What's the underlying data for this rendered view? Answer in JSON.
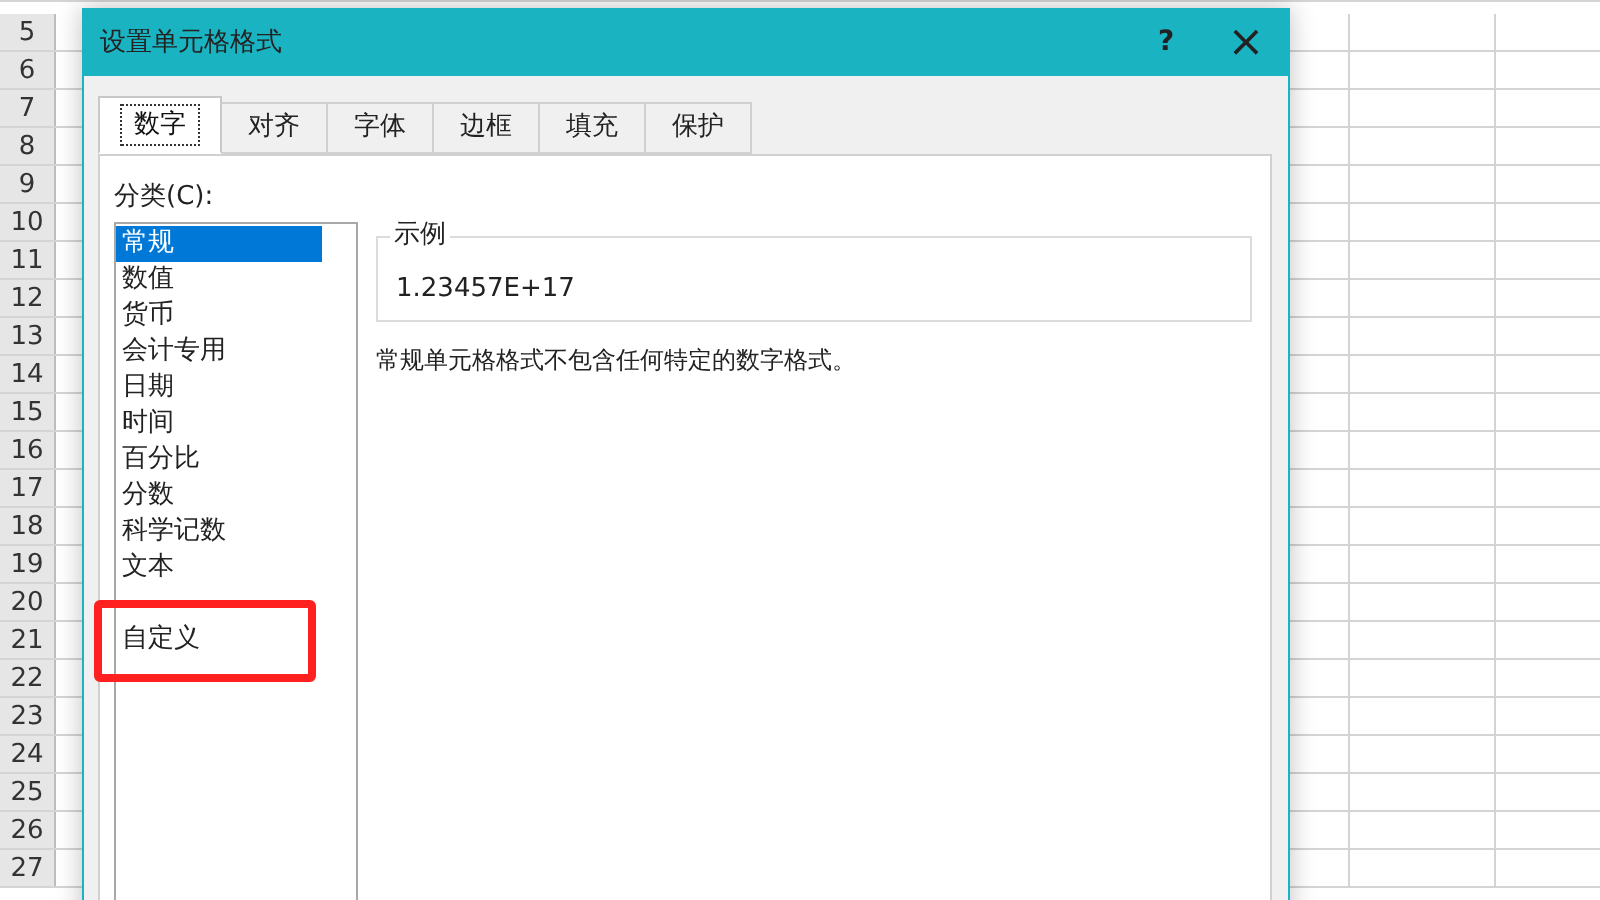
{
  "sheet": {
    "row_numbers": [
      "5",
      "6",
      "7",
      "8",
      "9",
      "10",
      "11",
      "12",
      "13",
      "14",
      "15",
      "16",
      "17",
      "18",
      "19",
      "20",
      "21",
      "22",
      "23",
      "24",
      "25",
      "26",
      "27"
    ]
  },
  "dialog": {
    "title": "设置单元格格式",
    "help": "?",
    "close": "×",
    "tabs": [
      {
        "label": "数字",
        "selected": true
      },
      {
        "label": "对齐",
        "selected": false
      },
      {
        "label": "字体",
        "selected": false
      },
      {
        "label": "边框",
        "selected": false
      },
      {
        "label": "填充",
        "selected": false
      },
      {
        "label": "保护",
        "selected": false
      }
    ],
    "category_label": "分类(C):",
    "categories": [
      {
        "kind": "option",
        "label": "常规",
        "selected": true
      },
      {
        "kind": "option",
        "label": "数值",
        "selected": false
      },
      {
        "kind": "option",
        "label": "货币",
        "selected": false
      },
      {
        "kind": "option",
        "label": "会计专用",
        "selected": false
      },
      {
        "kind": "option",
        "label": "日期",
        "selected": false
      },
      {
        "kind": "option",
        "label": "时间",
        "selected": false
      },
      {
        "kind": "option",
        "label": "百分比",
        "selected": false
      },
      {
        "kind": "option",
        "label": "分数",
        "selected": false
      },
      {
        "kind": "option",
        "label": "科学记数",
        "selected": false
      },
      {
        "kind": "option",
        "label": "文本",
        "selected": false
      },
      {
        "kind": "covered"
      },
      {
        "kind": "option",
        "label": "自定义",
        "selected": false
      }
    ],
    "sample": {
      "legend": "示例",
      "value": "1.23457E+17"
    },
    "description": "常规单元格格式不包含任何特定的数字格式。"
  },
  "annotation": {
    "color": "#ff2020"
  }
}
